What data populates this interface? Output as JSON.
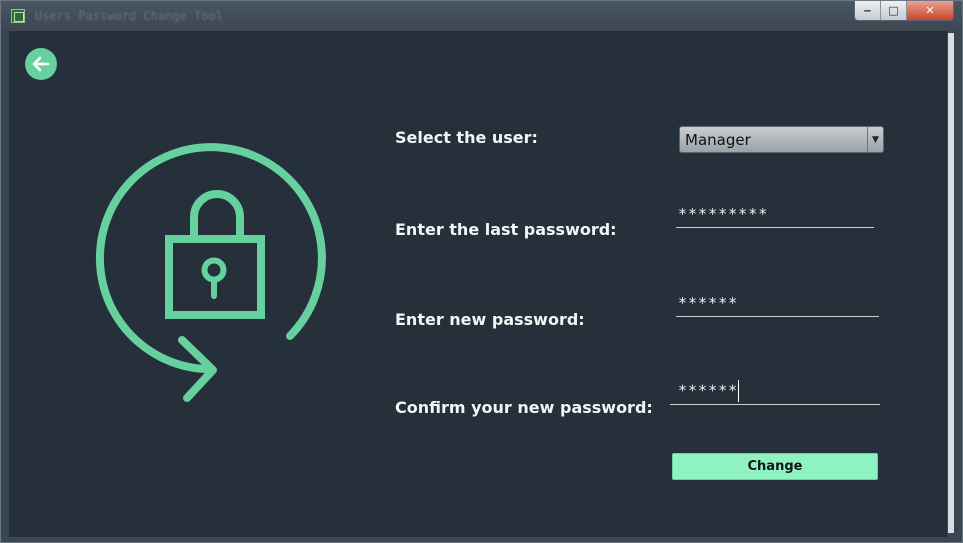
{
  "window": {
    "title": "Users Password Change Tool",
    "controls": {
      "minimize": "‒",
      "maximize": "□",
      "close": "✕"
    }
  },
  "nav": {
    "back_icon": "arrow-left-icon"
  },
  "illustration": {
    "icon": "lock-refresh-icon",
    "color": "#66d19e"
  },
  "form": {
    "user_label": "Select the user:",
    "user_value": "Manager",
    "last_password_label": "Enter the last password:",
    "last_password_value": "*********",
    "new_password_label": "Enter new password:",
    "new_password_value": "******",
    "confirm_password_label": "Confirm your new password:",
    "confirm_password_value": "******",
    "change_button": "Change"
  },
  "colors": {
    "background": "#26303a",
    "accent": "#66d19e",
    "button": "#8ff3c1"
  }
}
